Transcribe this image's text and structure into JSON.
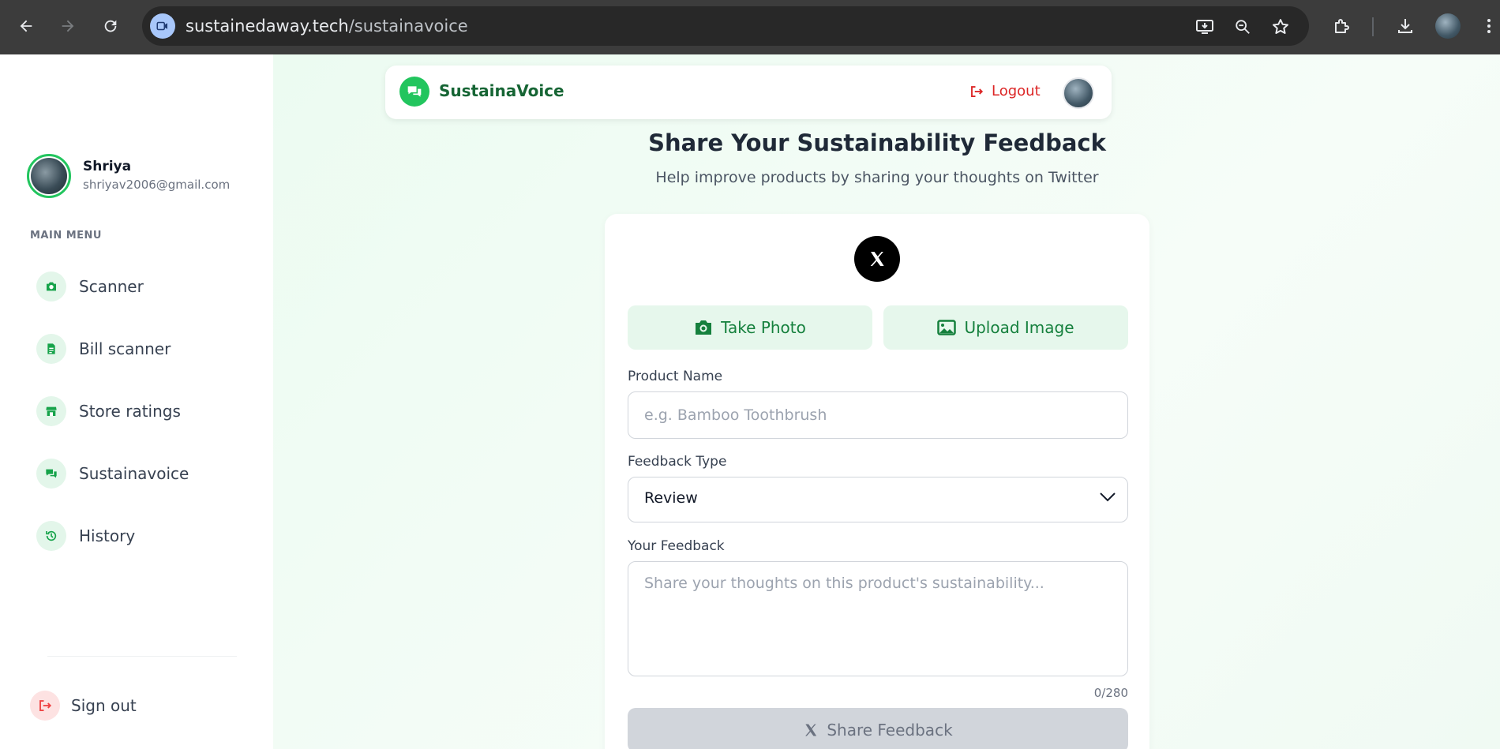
{
  "browser": {
    "url_host": "sustainedaway.tech",
    "url_path": "/sustainavoice",
    "icons": [
      "back-icon",
      "forward-icon",
      "reload-icon",
      "install-app-icon",
      "zoom-icon",
      "bookmark-star-icon",
      "extensions-icon",
      "download-icon",
      "chrome-menu-icon"
    ]
  },
  "sidebar": {
    "profile": {
      "name": "Shriya",
      "email": "shriyav2006@gmail.com"
    },
    "menu_heading": "MAIN MENU",
    "items": [
      {
        "label": "Scanner",
        "icon": "camera-icon"
      },
      {
        "label": "Bill scanner",
        "icon": "receipt-icon"
      },
      {
        "label": "Store ratings",
        "icon": "store-icon"
      },
      {
        "label": "Sustainavoice",
        "icon": "chat-icon"
      },
      {
        "label": "History",
        "icon": "history-icon"
      }
    ],
    "signout_label": "Sign out"
  },
  "topbar": {
    "brand": "SustainaVoice",
    "logout_label": "Logout"
  },
  "page": {
    "title": "Share Your Sustainability Feedback",
    "subtitle": "Help improve products by sharing your thoughts on Twitter"
  },
  "form": {
    "take_photo_label": "Take Photo",
    "upload_image_label": "Upload Image",
    "product_name_label": "Product Name",
    "product_name_placeholder": "e.g. Bamboo Toothbrush",
    "feedback_type_label": "Feedback Type",
    "feedback_type_value": "Review",
    "feedback_label": "Your Feedback",
    "feedback_placeholder": "Share your thoughts on this product's sustainability...",
    "counter": "0/280",
    "share_label": "Share Feedback"
  },
  "colors": {
    "accent_green": "#22c55e",
    "dark_green": "#166534",
    "logout_red": "#dc2626",
    "disabled_gray": "#d1d5db"
  }
}
